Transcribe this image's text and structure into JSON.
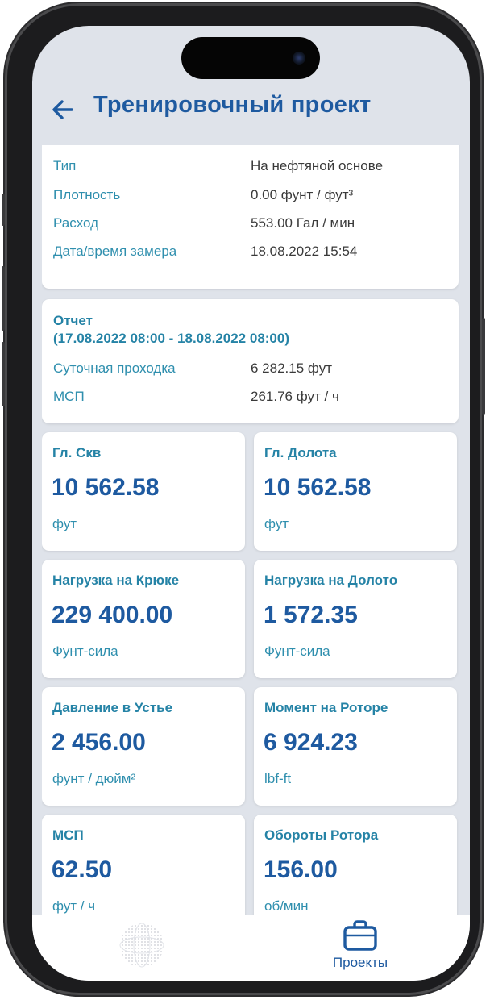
{
  "header": {
    "title": "Тренировочный проект",
    "back_icon": "arrow-left-icon"
  },
  "fluid_card": {
    "rows": [
      {
        "label": "Тип",
        "value": "На нефтяной основе"
      },
      {
        "label": "Плотность",
        "value": "0.00 фунт / фут³"
      },
      {
        "label": "Расход",
        "value": "553.00 Гал / мин"
      },
      {
        "label": "Дата/время замера",
        "value": "18.08.2022 15:54"
      }
    ]
  },
  "report_card": {
    "title": "Отчет",
    "period": "(17.08.2022 08:00 - 18.08.2022 08:00)",
    "rows": [
      {
        "label": "Суточная проходка",
        "value": "6 282.15 фут"
      },
      {
        "label": "МСП",
        "value": "261.76 фут / ч"
      }
    ]
  },
  "metrics": [
    {
      "label": "Гл. Скв",
      "value": "10 562.58",
      "unit": "фут"
    },
    {
      "label": "Гл. Долота",
      "value": "10 562.58",
      "unit": "фут"
    },
    {
      "label": "Нагрузка на Крюке",
      "value": "229 400.00",
      "unit": "Фунт-сила"
    },
    {
      "label": "Нагрузка на Долото",
      "value": "1 572.35",
      "unit": "Фунт-сила"
    },
    {
      "label": "Давление в Устье",
      "value": "2 456.00",
      "unit": "фунт / дюйм²"
    },
    {
      "label": "Момент на Роторе",
      "value": "6 924.23",
      "unit": "lbf-ft"
    },
    {
      "label": "МСП",
      "value": "62.50",
      "unit": "фут / ч"
    },
    {
      "label": "Обороты Ротора",
      "value": "156.00",
      "unit": "об/мин"
    }
  ],
  "tabbar": {
    "globe_icon": "globe-icon",
    "projects_icon": "briefcase-icon",
    "projects_label": "Проекты"
  },
  "colors": {
    "accent": "#1e5aa0",
    "label": "#2f8fae",
    "background": "#dfe3ea"
  }
}
